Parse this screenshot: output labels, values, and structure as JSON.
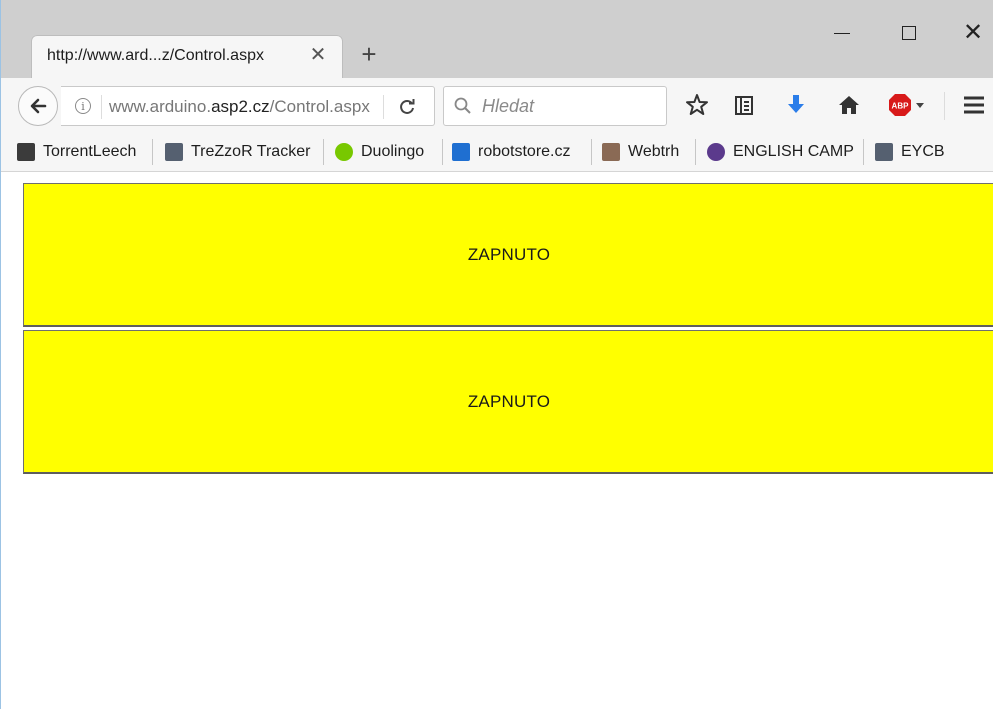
{
  "browser": {
    "tab_title": "http://www.ard...z/Control.aspx",
    "url": {
      "prefix": "www.arduino.",
      "host": "asp2.cz",
      "path": "/Control.aspx"
    },
    "search_placeholder": "Hledat"
  },
  "bookmarks": [
    {
      "label": "TorrentLeech",
      "icon": "torrentleech-icon",
      "color": "#3b3b3b"
    },
    {
      "label": "TreZzoR Tracker",
      "icon": "trezzor-icon",
      "color": "#556070"
    },
    {
      "label": "Duolingo",
      "icon": "duolingo-owl-icon",
      "color": "#78c800"
    },
    {
      "label": "robotstore.cz",
      "icon": "robotstore-icon",
      "color": "#1f6fd1"
    },
    {
      "label": "Webtrh",
      "icon": "webtrh-icon",
      "color": "#8a6a55"
    },
    {
      "label": "ENGLISH CAMP",
      "icon": "english-camp-icon",
      "color": "#5b3a8c"
    },
    {
      "label": "EYCB",
      "icon": "eycb-icon",
      "color": "#556070"
    }
  ],
  "content": {
    "panels": [
      {
        "label": "ZAPNUTO",
        "color": "#ffff00"
      },
      {
        "label": "ZAPNUTO",
        "color": "#ffff00"
      }
    ]
  }
}
